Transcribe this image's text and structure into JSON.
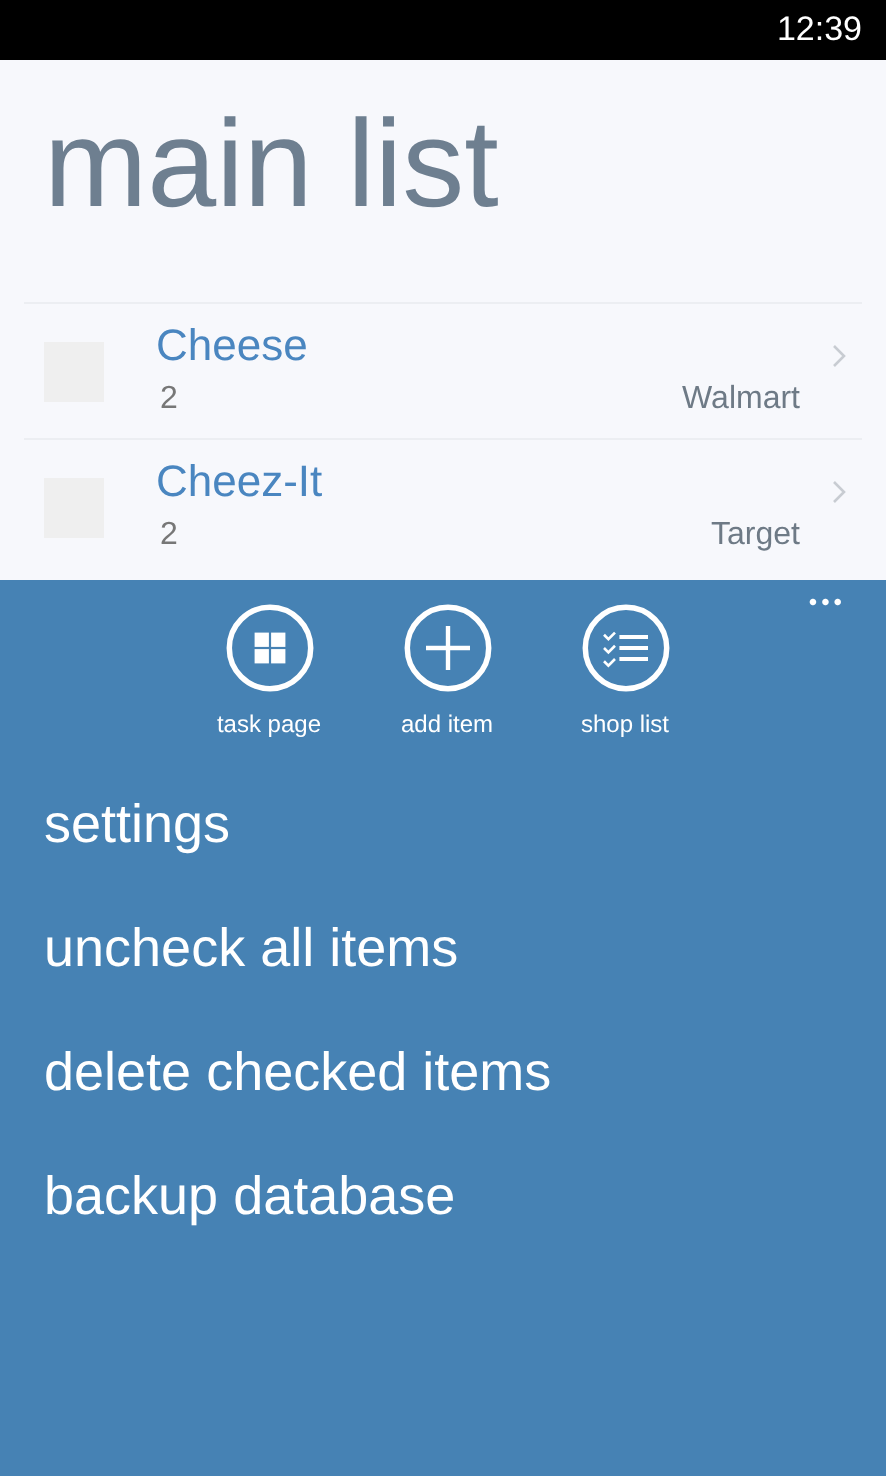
{
  "status_bar": {
    "time": "12:39"
  },
  "title": "main list",
  "items": [
    {
      "name": "Cheese",
      "quantity": "2",
      "store": "Walmart",
      "checked": false
    },
    {
      "name": "Cheez-It",
      "quantity": "2",
      "store": "Target",
      "checked": false
    }
  ],
  "app_bar": {
    "more": "•••",
    "buttons": [
      {
        "kind": "grid",
        "label": "task page"
      },
      {
        "kind": "add",
        "label": "add item"
      },
      {
        "kind": "list",
        "label": "shop list"
      }
    ],
    "menu": [
      "settings",
      "uncheck all items",
      "delete checked items",
      "backup database"
    ]
  }
}
